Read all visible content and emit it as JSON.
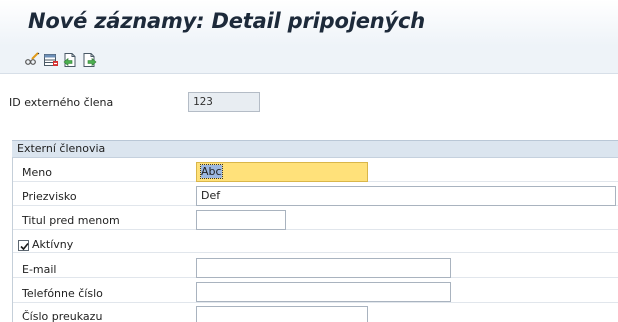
{
  "header": {
    "title": "Nové záznamy: Detail pripojených"
  },
  "toolbar": {
    "icons": [
      "edit-glasses-icon",
      "table-view-icon",
      "previous-entry-icon",
      "next-entry-icon"
    ]
  },
  "id_section": {
    "label": "ID externého člena",
    "value": "123"
  },
  "group": {
    "title": "Externí členovia",
    "fields": {
      "meno": {
        "label": "Meno",
        "value": "Abc"
      },
      "priezvisko": {
        "label": "Priezvisko",
        "value": "Def"
      },
      "titul": {
        "label": "Titul pred menom",
        "value": ""
      },
      "aktivny": {
        "label": "Aktívny",
        "checked": true
      },
      "email": {
        "label": "E-mail",
        "value": ""
      },
      "telefon": {
        "label": "Telefónne číslo",
        "value": ""
      },
      "preukaz": {
        "label": "Číslo preukazu",
        "value": ""
      }
    }
  },
  "colors": {
    "focused_field": "#ffe17a",
    "group_header": "#dbe5ef",
    "title_text": "#1d2a3a"
  }
}
